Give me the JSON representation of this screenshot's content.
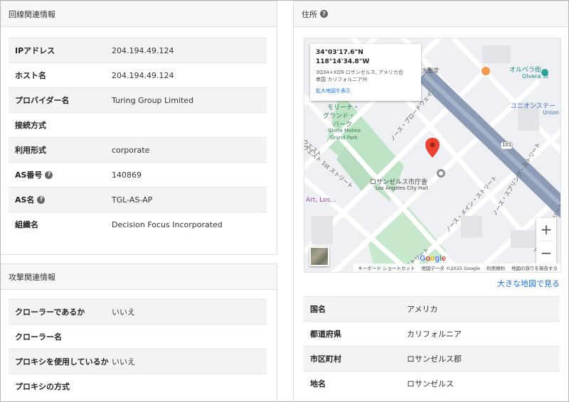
{
  "left": {
    "line_info": {
      "title": "回線関連情報",
      "rows": [
        {
          "label": "IPアドレス",
          "value": "204.194.49.124"
        },
        {
          "label": "ホスト名",
          "value": "204.194.49.124"
        },
        {
          "label": "プロバイダー名",
          "value": "Turing Group Limited"
        },
        {
          "label": "接続方式",
          "value": ""
        },
        {
          "label": "利用形式",
          "value": "corporate"
        },
        {
          "label": "AS番号",
          "value": "140869",
          "help": "?"
        },
        {
          "label": "AS名",
          "value": "TGL-AS-AP",
          "help": "?"
        },
        {
          "label": "組織名",
          "value": "Decision Focus Incorporated"
        }
      ]
    },
    "attack_info": {
      "title": "攻撃関連情報",
      "rows": [
        {
          "label": "クローラーであるか",
          "value": "いいえ"
        },
        {
          "label": "クローラー名",
          "value": ""
        },
        {
          "label": "プロキシを使用しているか",
          "value": "いいえ"
        },
        {
          "label": "プロキシの方式",
          "value": ""
        }
      ]
    }
  },
  "right": {
    "address": {
      "title": "住所",
      "help": "?",
      "map": {
        "popup": {
          "coords": "34°03'17.6\"N 118°14'34.8\"W",
          "address_line1": "3Q34+XQ9 ロサンゼルス, アメリカ合",
          "address_line2": "衆国 カリフォルニア州",
          "enlarge": "拡大地図を表示"
        },
        "labels": {
          "city_hall_ja": "ロサンゼルス市庁舎",
          "city_hall_en": "Los Angeles City Hall",
          "gloria_ja_1": "モリーナ・",
          "gloria_ja_2": "グランド・",
          "gloria_ja_3": "パーク",
          "gloria_en_1": "Gloria Molina",
          "gloria_en_2": "Grand Park",
          "broadway": "ノース・ブロードウェイ",
          "first_st": "ウエスト 1st ストリート",
          "main_st": "ノース・メイン・ストリート",
          "spring_st": "ノース・スプリング・ストリート",
          "olvera_ja": "オルベラ街",
          "olvera_en": "Olvera St",
          "union": "ユニオンステー",
          "union_en": "Union",
          "cathedral": "大聖堂",
          "art": "Art, Los...",
          "hwy": "101",
          "street_bottom": "ストリート",
          "alameda": "アラメダ・ストリート",
          "west": "ウエスト"
        },
        "zoom_in": "+",
        "zoom_out": "−",
        "google": "Google",
        "attribution": [
          "キーボード ショートカット",
          "地図データ ©2025 Google",
          "利用規約",
          "地図の誤りを報告する"
        ]
      },
      "big_map_link": "大きな地図で見る",
      "rows": [
        {
          "label": "国名",
          "value": "アメリカ"
        },
        {
          "label": "都道府県",
          "value": "カリフォルニア"
        },
        {
          "label": "市区町村",
          "value": "ロサンゼルス郡"
        },
        {
          "label": "地名",
          "value": "ロサンゼルス"
        }
      ]
    }
  },
  "colors": {
    "accent_link": "#1a73e8",
    "map_pin": "#ea4335",
    "park_green": "#bfe3c6",
    "highway": "#8c9bb5"
  }
}
